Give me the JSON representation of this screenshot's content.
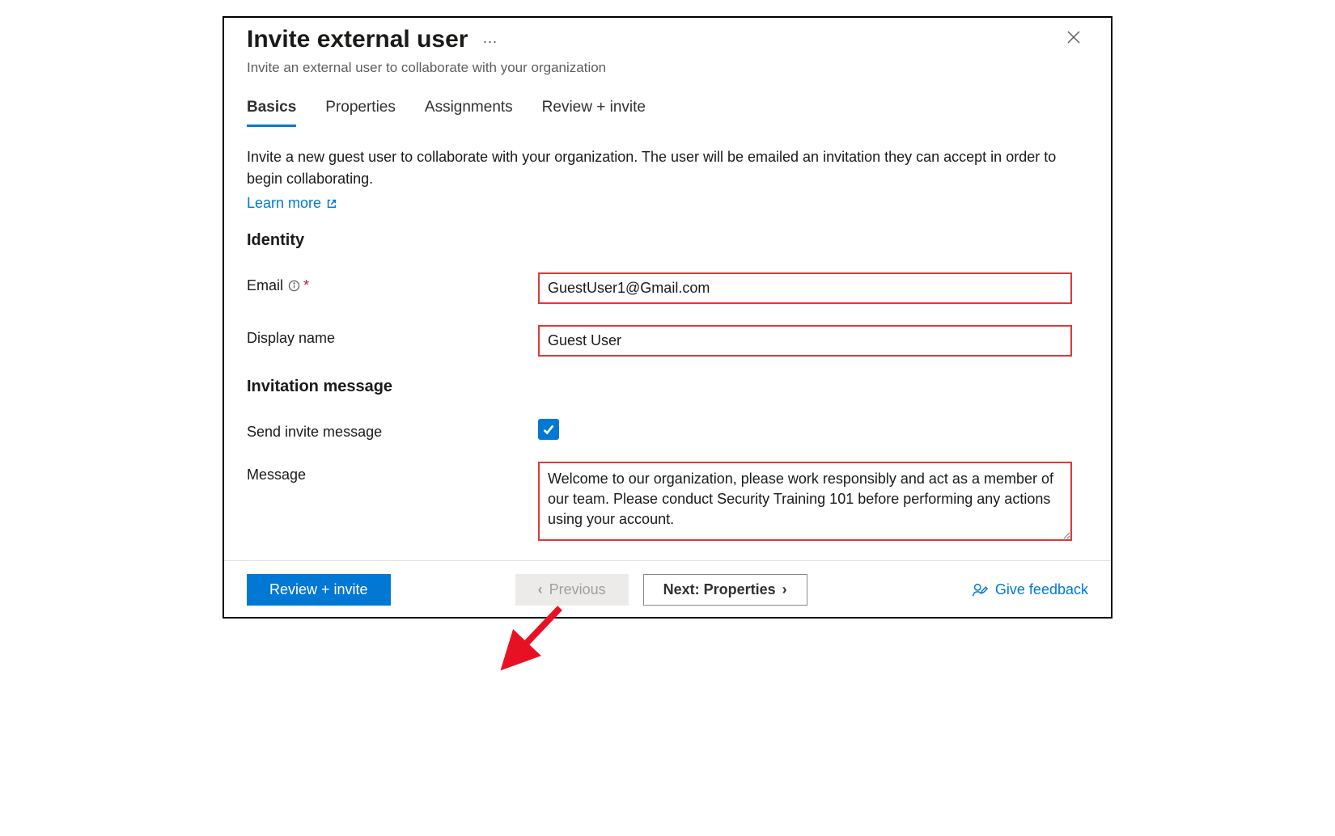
{
  "header": {
    "title": "Invite external user",
    "subtitle": "Invite an external user to collaborate with your organization"
  },
  "tabs": [
    {
      "label": "Basics",
      "active": true
    },
    {
      "label": "Properties",
      "active": false
    },
    {
      "label": "Assignments",
      "active": false
    },
    {
      "label": "Review + invite",
      "active": false
    }
  ],
  "description": "Invite a new guest user to collaborate with your organization. The user will be emailed an invitation they can accept in order to begin collaborating.",
  "learn_more_label": "Learn more",
  "sections": {
    "identity": {
      "heading": "Identity",
      "email_label": "Email",
      "email_value": "GuestUser1@Gmail.com",
      "display_name_label": "Display name",
      "display_name_value": "Guest User"
    },
    "invitation": {
      "heading": "Invitation message",
      "send_label": "Send invite message",
      "send_checked": true,
      "message_label": "Message",
      "message_value": "Welcome to our organization, please work responsibly and act as a member of our team. Please conduct Security Training 101 before performing any actions using your account."
    }
  },
  "footer": {
    "review_label": "Review + invite",
    "previous_label": "Previous",
    "next_label": "Next: Properties",
    "feedback_label": "Give feedback"
  }
}
